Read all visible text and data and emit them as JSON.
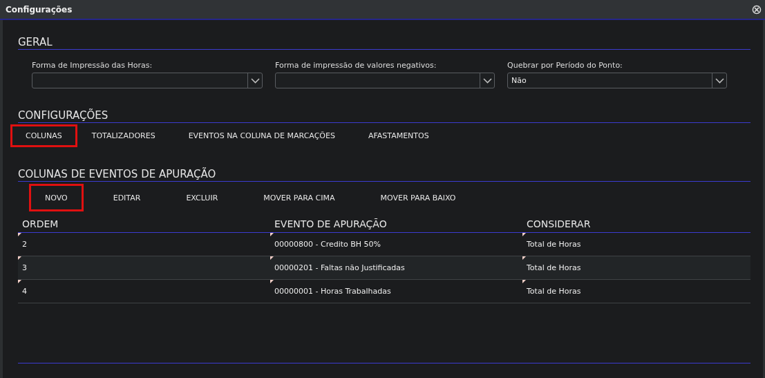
{
  "window": {
    "title": "Configurações",
    "close_icon": "⊗"
  },
  "geral": {
    "heading": "GERAL",
    "fields": [
      {
        "label": "Forma de Impressão das Horas:"
      },
      {
        "label": "Forma de impressão de valores negativos:"
      },
      {
        "label": "Quebrar por Período do Ponto:",
        "value": "Não"
      }
    ]
  },
  "configuracoes": {
    "heading": "CONFIGURAÇÕES",
    "tabs": [
      {
        "label": "COLUNAS",
        "highlighted": true
      },
      {
        "label": "TOTALIZADORES",
        "highlighted": false
      },
      {
        "label": "EVENTOS NA COLUNA DE MARCAÇÕES",
        "highlighted": false
      },
      {
        "label": "AFASTAMENTOS",
        "highlighted": false
      }
    ]
  },
  "colunas": {
    "heading": "COLUNAS DE EVENTOS DE APURAÇÃO",
    "buttons": [
      {
        "label": "NOVO",
        "highlighted": true
      },
      {
        "label": "EDITAR",
        "highlighted": false
      },
      {
        "label": "EXCLUIR",
        "highlighted": false
      },
      {
        "label": "MOVER PARA CIMA",
        "highlighted": false
      },
      {
        "label": "MOVER PARA BAIXO",
        "highlighted": false
      }
    ],
    "table": {
      "columns": [
        "ORDEM",
        "EVENTO DE APURAÇÃO",
        "CONSIDERAR"
      ],
      "rows": [
        [
          "2",
          "00000800 - Credito BH 50%",
          "Total de Horas"
        ],
        [
          "3",
          "00000201 - Faltas não Justificadas",
          "Total de Horas"
        ],
        [
          "4",
          "00000001 - Horas Trabalhadas",
          "Total de Horas"
        ]
      ]
    }
  }
}
